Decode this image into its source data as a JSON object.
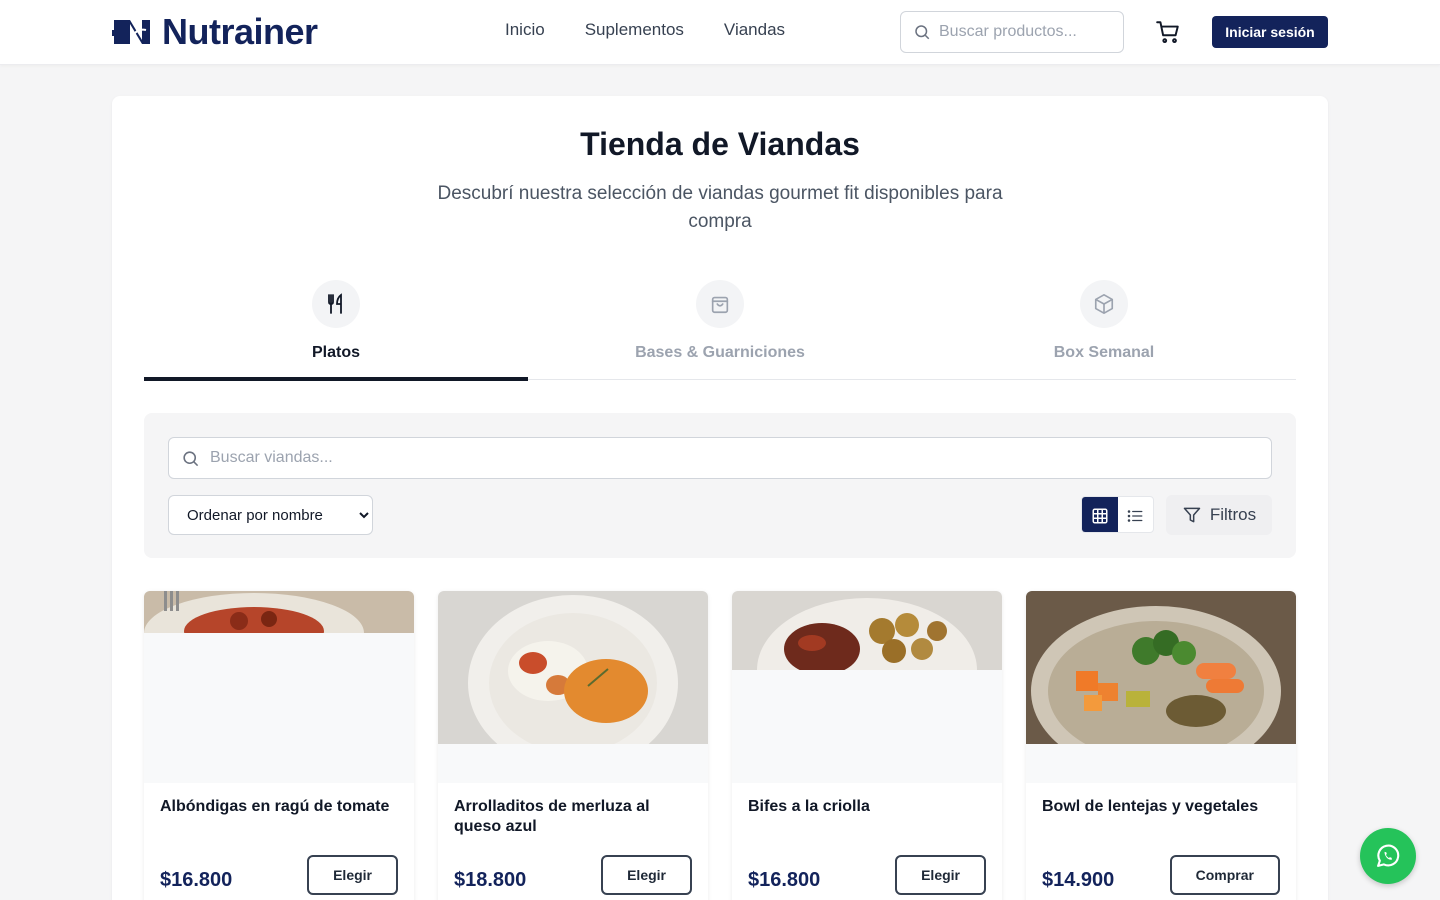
{
  "header": {
    "brand": "Nutrainer",
    "nav": [
      "Inicio",
      "Suplementos",
      "Viandas"
    ],
    "search_placeholder": "Buscar productos...",
    "login_label": "Iniciar sesión",
    "brand_color": "#13235b"
  },
  "page": {
    "title": "Tienda de Viandas",
    "subtitle": "Descubrí nuestra selección de viandas gourmet fit disponibles para compra"
  },
  "tabs": [
    {
      "label": "Platos",
      "icon": "fork-knife-icon",
      "active": true
    },
    {
      "label": "Bases & Guarniciones",
      "icon": "shopping-bag-icon",
      "active": false
    },
    {
      "label": "Box Semanal",
      "icon": "box-icon",
      "active": false
    }
  ],
  "filters": {
    "search_placeholder": "Buscar viandas...",
    "sort_selected": "Ordenar por nombre",
    "filters_label": "Filtros",
    "view_mode": "grid"
  },
  "products": [
    {
      "name": "Albóndigas en ragú de tomate",
      "price": "$16.800",
      "action": "Elegir"
    },
    {
      "name": "Arrolladitos de merluza al queso azul",
      "price": "$18.800",
      "action": "Elegir"
    },
    {
      "name": "Bifes a la criolla",
      "price": "$16.800",
      "action": "Elegir"
    },
    {
      "name": "Bowl de lentejas y vegetales",
      "price": "$14.900",
      "action": "Comprar"
    }
  ],
  "whatsapp": {
    "icon": "whatsapp-icon",
    "color": "#25c35a"
  }
}
